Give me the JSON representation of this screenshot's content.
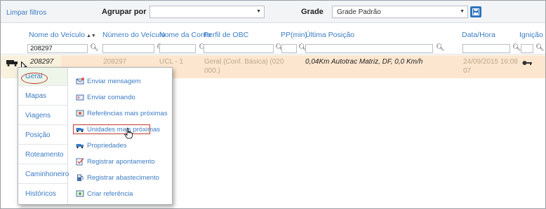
{
  "toolbar": {
    "clear_filters": "Limpar filtros",
    "group_by_label": "Agrupar por",
    "group_by_value": "",
    "grid_label": "Grade",
    "grid_value": "Grade Padrão"
  },
  "columns": [
    "Nome do Veículo",
    "Número do Veículo",
    "Nome da Conta",
    "Perfil de OBC",
    "PP(min)",
    "Última Posição",
    "Data/Hora",
    "Ignição"
  ],
  "filters": {
    "vehicle_name": "208297"
  },
  "row": {
    "vehicle_name": "208297",
    "vehicle_number": "208297",
    "account": "UCL - 1",
    "obc_profile_line1": "Geral (Conf. Básica) (020",
    "obc_profile_line2": "000.)",
    "last_position": "0,04Km Autotrac Matriz, DF, 0,0 Km/h",
    "datetime_line1": "24/09/2015 16:08",
    "datetime_line2": "07"
  },
  "context_menu": {
    "categories": [
      "Geral",
      "Mapas",
      "Viagens",
      "Posição",
      "Roteamento",
      "Caminhoneiro",
      "Históricos"
    ],
    "active_category": "Geral",
    "items": [
      {
        "label": "Enviar mensagem",
        "icon": "envelope-icon"
      },
      {
        "label": "Enviar comando",
        "icon": "command-icon"
      },
      {
        "label": "Referências mais próximas",
        "icon": "map-reference-icon"
      },
      {
        "label": "Unidades mais próximas",
        "icon": "truck-nearby-icon"
      },
      {
        "label": "Propriedades",
        "icon": "truck-properties-icon"
      },
      {
        "label": "Registrar apontamento",
        "icon": "checkmark-icon"
      },
      {
        "label": "Registrar abastecimento",
        "icon": "fuel-pump-icon"
      },
      {
        "label": "Criar referência",
        "icon": "create-reference-icon"
      }
    ]
  },
  "colors": {
    "link_blue": "#3b7cc4",
    "row_highlight": "#fde6cf",
    "annotation_red": "#c0392b",
    "save_button": "#2f74c0"
  }
}
